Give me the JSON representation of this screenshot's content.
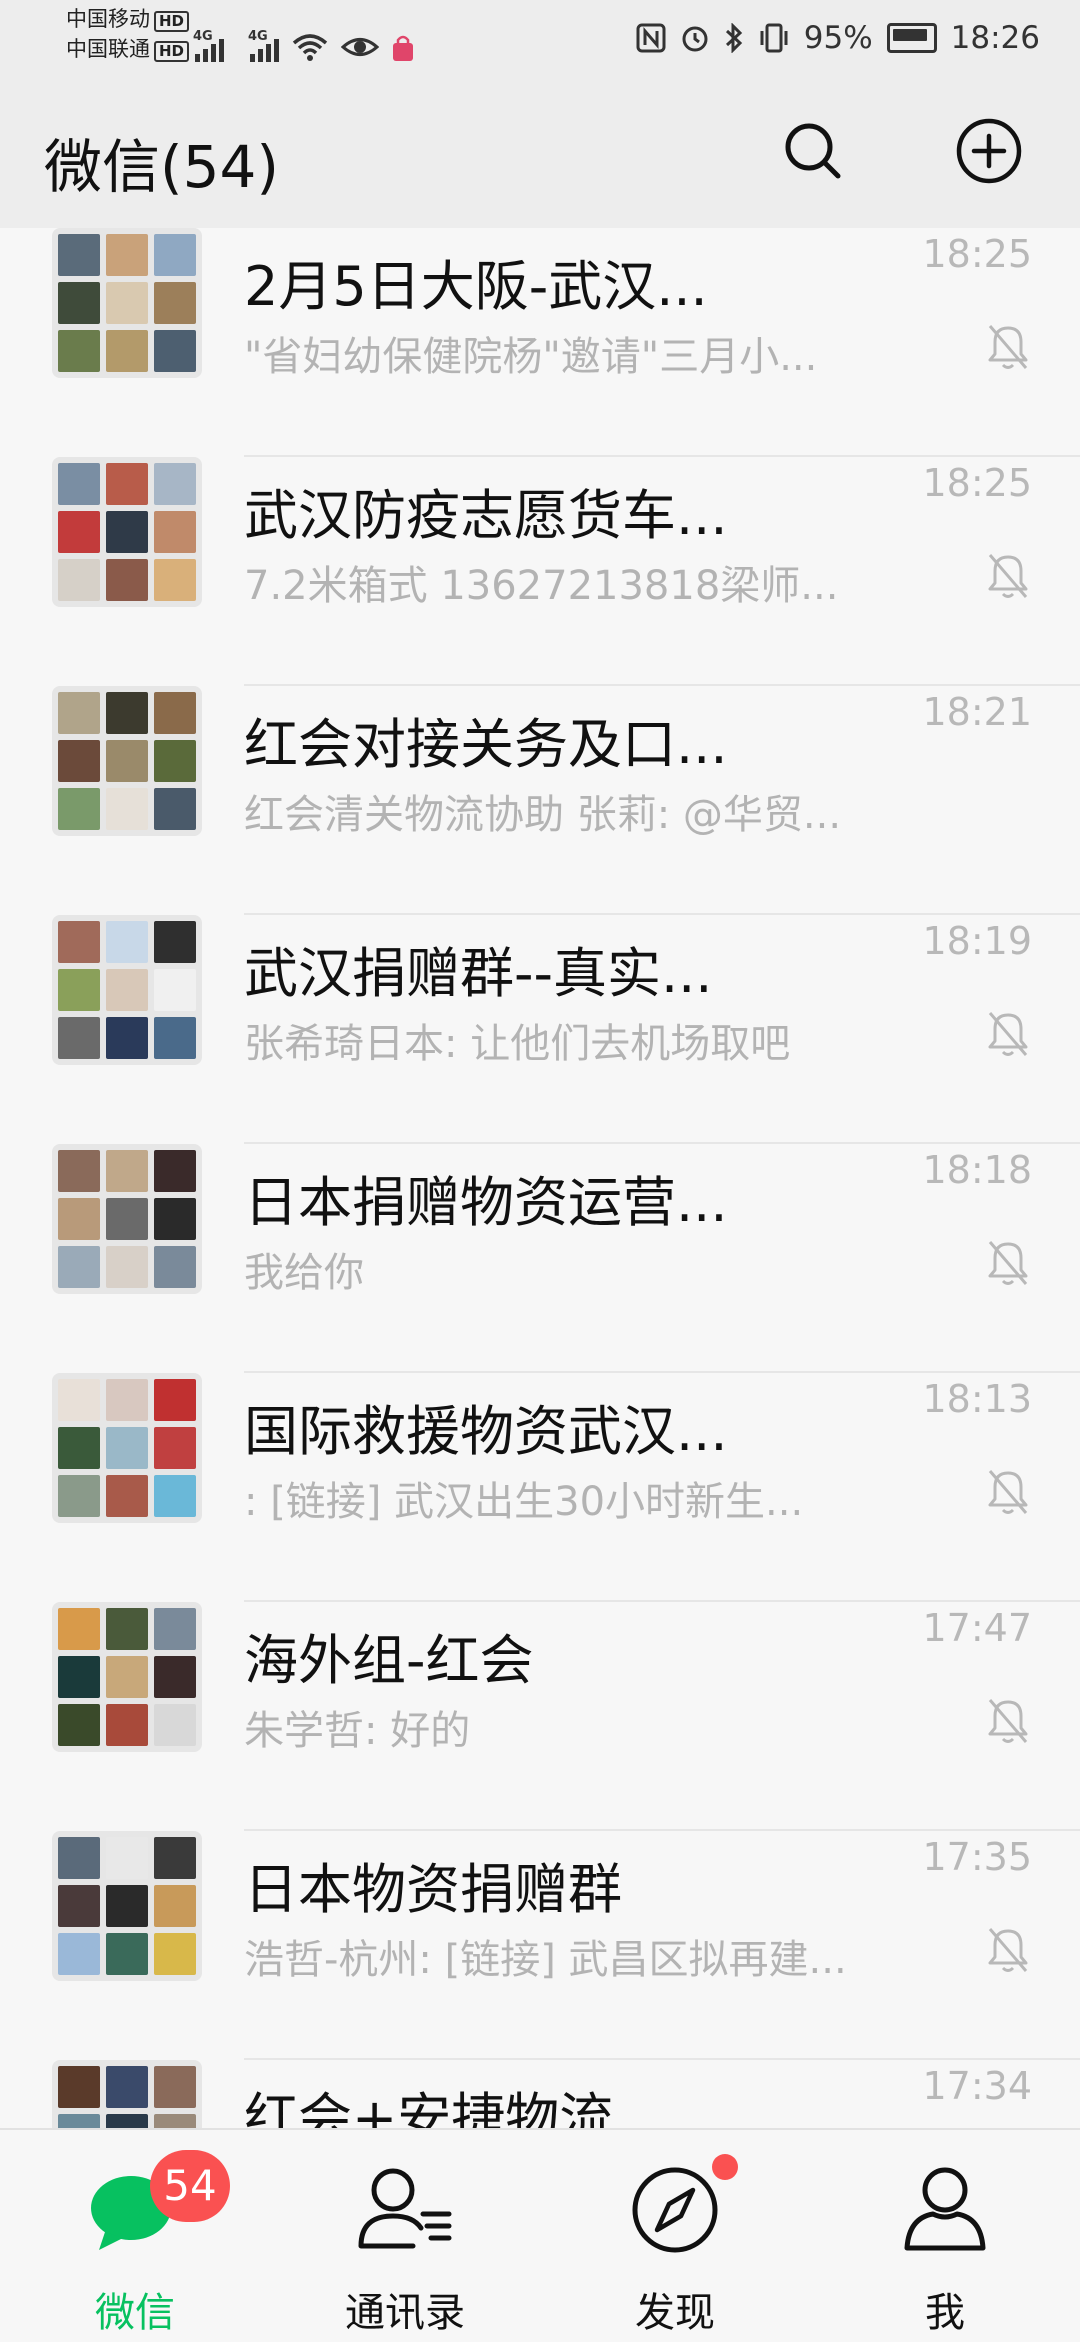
{
  "status_bar": {
    "carrier1": "中国移动",
    "carrier2": "中国联通",
    "hd": "HD",
    "net1": "4G",
    "net2": "4G",
    "battery_percent": "95%",
    "time": "18:26",
    "icons": [
      "nfc-icon",
      "alarm-icon",
      "bluetooth-icon",
      "vibrate-icon",
      "wifi-icon",
      "eye-icon",
      "shopping-bag-icon",
      "battery-icon"
    ]
  },
  "header": {
    "title": "微信(54)",
    "search_icon": "search-icon",
    "add_icon": "plus-circle-icon"
  },
  "chats": [
    {
      "title": "2月5日大阪-武汉...",
      "preview": "\"省妇幼保健院杨\"邀请\"三月小...",
      "time": "18:25",
      "muted": true
    },
    {
      "title": "武汉防疫志愿货车...",
      "preview": "7.2米箱式 13627213818梁师...",
      "time": "18:25",
      "muted": true
    },
    {
      "title": "红会对接关务及口...",
      "preview": "红会清关物流协助 张莉: @华贸...",
      "time": "18:21",
      "muted": false
    },
    {
      "title": "武汉捐赠群--真实...",
      "preview": "张希琦日本: 让他们去机场取吧",
      "time": "18:19",
      "muted": true
    },
    {
      "title": "日本捐赠物资运营...",
      "preview": "我给你",
      "time": "18:18",
      "muted": true
    },
    {
      "title": "国际救援物资武汉...",
      "preview": "  : [链接] 武汉出生30小时新生...",
      "time": "18:13",
      "muted": true
    },
    {
      "title": "海外组-红会",
      "preview": "朱学哲: 好的",
      "time": "17:47",
      "muted": true
    },
    {
      "title": "日本物资捐赠群",
      "preview": "浩哲-杭州: [链接] 武昌区拟再建...",
      "time": "17:35",
      "muted": true
    },
    {
      "title": "红会+安捷物流",
      "preview": "",
      "time": "17:34",
      "muted": false
    }
  ],
  "tabs": [
    {
      "label": "微信",
      "icon": "chat-bubble-icon",
      "badge": "54",
      "active": true
    },
    {
      "label": "通讯录",
      "icon": "contacts-icon",
      "badge": "",
      "active": false
    },
    {
      "label": "发现",
      "icon": "compass-icon",
      "badge": "",
      "dot": true,
      "active": false
    },
    {
      "label": "我",
      "icon": "person-icon",
      "badge": "",
      "active": false
    }
  ],
  "colors": {
    "accent": "#07c160",
    "badge": "#fa5151",
    "header_bg": "#ededed",
    "list_bg": "#f7f7f7",
    "muted_text": "#b3b3b3"
  }
}
